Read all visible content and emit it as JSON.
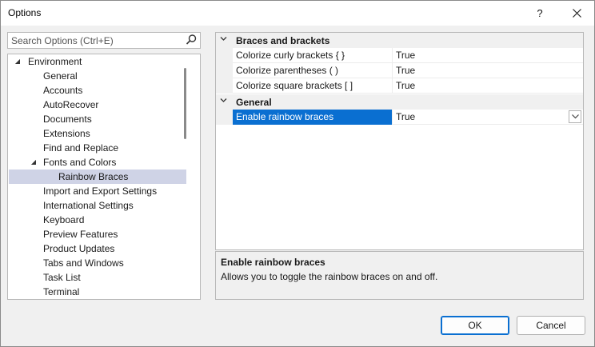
{
  "window": {
    "title": "Options",
    "help_label": "?",
    "close_label": "✕"
  },
  "search": {
    "placeholder": "Search Options (Ctrl+E)"
  },
  "tree": {
    "items": [
      {
        "label": "Environment",
        "expanded": true
      },
      {
        "label": "General"
      },
      {
        "label": "Accounts"
      },
      {
        "label": "AutoRecover"
      },
      {
        "label": "Documents"
      },
      {
        "label": "Extensions"
      },
      {
        "label": "Find and Replace"
      },
      {
        "label": "Fonts and Colors",
        "expanded": true
      },
      {
        "label": "Rainbow Braces",
        "selected": true
      },
      {
        "label": "Import and Export Settings"
      },
      {
        "label": "International Settings"
      },
      {
        "label": "Keyboard"
      },
      {
        "label": "Preview Features"
      },
      {
        "label": "Product Updates"
      },
      {
        "label": "Tabs and Windows"
      },
      {
        "label": "Task List"
      },
      {
        "label": "Terminal"
      }
    ]
  },
  "grid": {
    "categories": [
      {
        "label": "Braces and brackets",
        "properties": [
          {
            "name": "Colorize curly brackets { }",
            "value": "True"
          },
          {
            "name": "Colorize parentheses ( )",
            "value": "True"
          },
          {
            "name": "Colorize square brackets [ ]",
            "value": "True"
          }
        ]
      },
      {
        "label": "General",
        "properties": [
          {
            "name": "Enable rainbow braces",
            "value": "True",
            "selected": true
          }
        ]
      }
    ]
  },
  "description": {
    "title": "Enable rainbow braces",
    "text": "Allows you to toggle the rainbow braces on and off."
  },
  "buttons": {
    "ok": "OK",
    "cancel": "Cancel"
  },
  "colors": {
    "selection": "#0a6fd1",
    "tree_selection": "#cfd3e6",
    "chrome": "#f0f0f0"
  }
}
